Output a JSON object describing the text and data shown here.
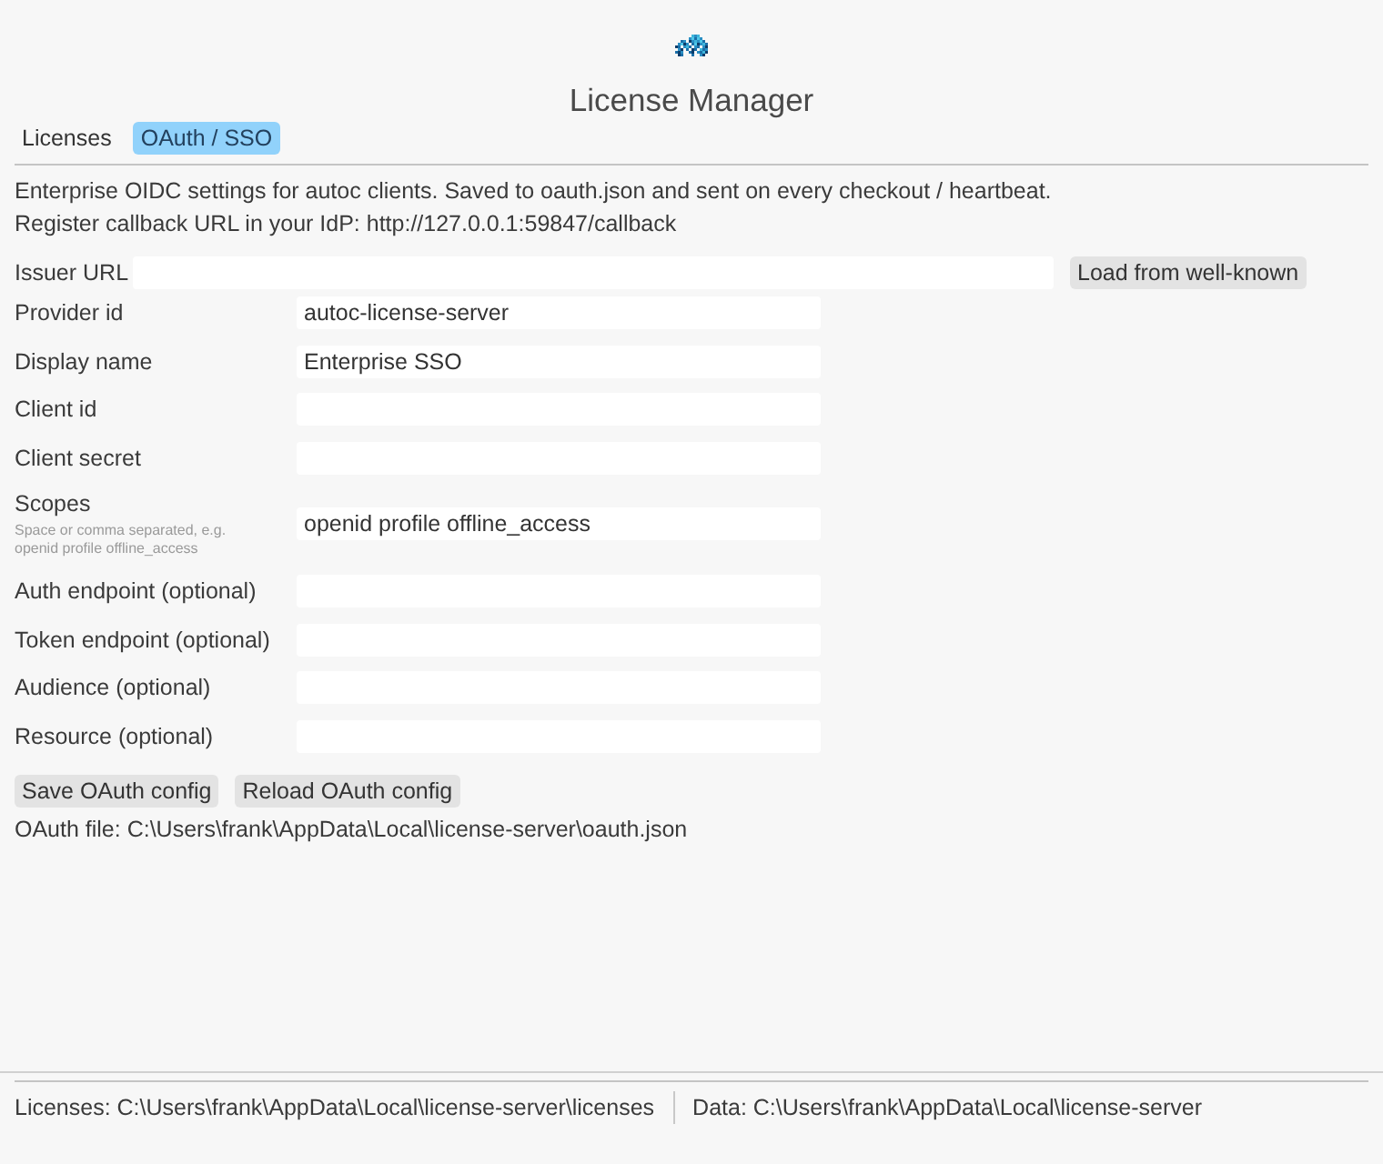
{
  "app": {
    "title": "License Manager"
  },
  "tabs": [
    {
      "label": "Licenses",
      "selected": false
    },
    {
      "label": "OAuth / SSO",
      "selected": true
    }
  ],
  "description": [
    "Enterprise OIDC settings for autoc clients. Saved to oauth.json and sent on every checkout / heartbeat.",
    "Register callback URL in your IdP: http://127.0.0.1:59847/callback"
  ],
  "issuer": {
    "label": "Issuer URL",
    "button": "Load from well-known"
  },
  "fields": [
    {
      "label": "Provider id",
      "value": "autoc-license-server"
    },
    {
      "label": "Display name",
      "value": "Enterprise SSO"
    },
    {
      "label": "Client id"
    },
    {
      "label": "Client secret"
    },
    {
      "label": "Scopes",
      "hint": "Space or comma separated, e.g. openid profile offline_access",
      "value": "openid profile offline_access"
    },
    {
      "label": "Auth endpoint (optional)"
    },
    {
      "label": "Token endpoint (optional)"
    },
    {
      "label": "Audience (optional)"
    },
    {
      "label": "Resource (optional)"
    }
  ],
  "actions": [
    "Save OAuth config",
    "Reload OAuth config"
  ],
  "oauth_file": "OAuth file: C:\\Users\\frank\\AppData\\Local\\license-server\\oauth.json",
  "status_bar": [
    "Licenses: C:\\Users\\frank\\AppData\\Local\\license-server\\licenses",
    "Data: C:\\Users\\frank\\AppData\\Local\\license-server"
  ]
}
